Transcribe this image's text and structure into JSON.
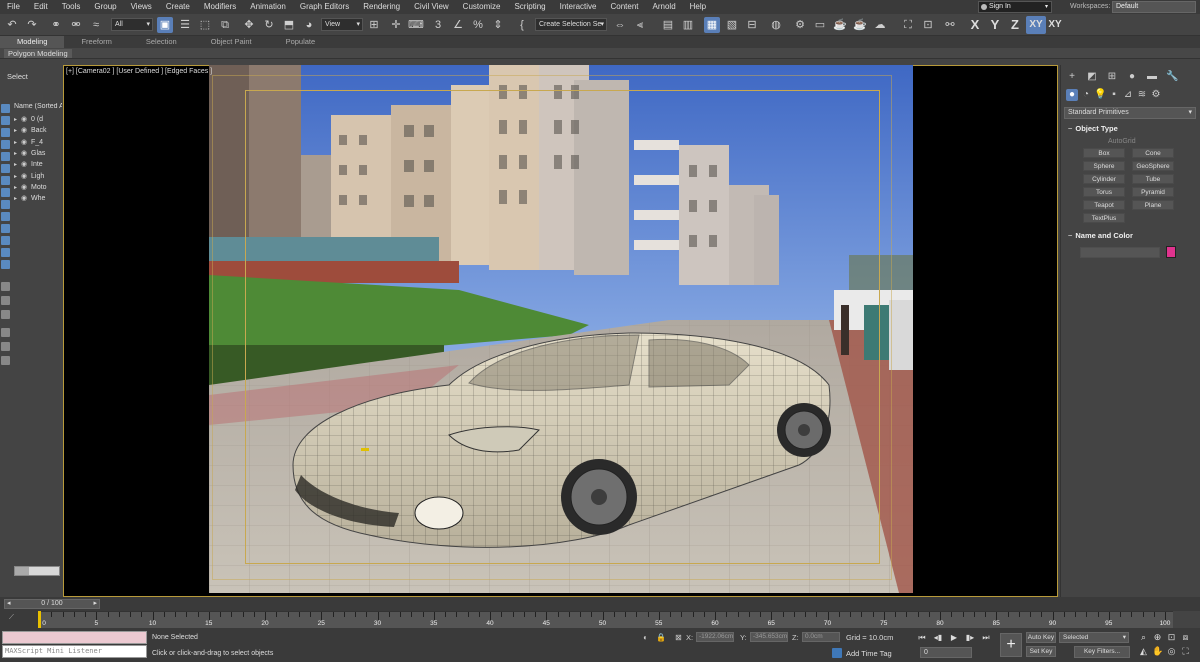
{
  "menu": [
    "File",
    "Edit",
    "Tools",
    "Group",
    "Views",
    "Create",
    "Modifiers",
    "Animation",
    "Graph Editors",
    "Rendering",
    "Civil View",
    "Customize",
    "Scripting",
    "Interactive",
    "Content",
    "Arnold",
    "Help"
  ],
  "account": {
    "sign_in": "Sign In",
    "workspaces_label": "Workspaces:",
    "workspace": "Default"
  },
  "toolbar": {
    "filter": "All",
    "ref_coord": "View",
    "selection_set": "Create Selection Se",
    "axis_x": "X",
    "axis_y": "Y",
    "axis_z": "Z",
    "axis_xy": "XY",
    "axis_xy2": "XY"
  },
  "ribbon": {
    "tabs": [
      "Modeling",
      "Freeform",
      "Selection",
      "Object Paint",
      "Populate"
    ],
    "subtab": "Polygon Modeling"
  },
  "scene_explorer": {
    "select_label": "Select",
    "header": "Name (Sorted A",
    "rows": [
      "0 (d",
      "Back",
      "F_4",
      "Glas",
      "Inte",
      "Ligh",
      "Moto",
      "Whe"
    ]
  },
  "viewport": {
    "label": "[+] [Camera02 ] [User Defined ] [Edged Faces ]"
  },
  "command_panel": {
    "category": "Standard Primitives",
    "object_type_title": "Object Type",
    "autogrid": "AutoGrid",
    "primitives": [
      "Box",
      "Cone",
      "Sphere",
      "GeoSphere",
      "Cylinder",
      "Tube",
      "Torus",
      "Pyramid",
      "Teapot",
      "Plane",
      "TextPlus"
    ],
    "name_color_title": "Name and Color",
    "object_color": "#e0338e"
  },
  "timeline": {
    "frame_range": "0 / 100",
    "tick_labels": [
      "0",
      "5",
      "10",
      "15",
      "20",
      "25",
      "30",
      "35",
      "40",
      "45",
      "50",
      "55",
      "60",
      "65",
      "70",
      "75",
      "80",
      "85",
      "90",
      "95",
      "100"
    ]
  },
  "status": {
    "maxscript": "MAXScript Mini Listener",
    "selection": "None Selected",
    "prompt": "Click or click-and-drag to select objects",
    "x_label": "X:",
    "x_value": "-1922.06cm",
    "y_label": "Y:",
    "y_value": "-345.653cm",
    "z_label": "Z:",
    "z_value": "0.0cm",
    "grid": "Grid = 10.0cm",
    "add_time_tag": "Add Time Tag",
    "current_frame": "0",
    "auto_key": "Auto Key",
    "set_key": "Set Key",
    "key_mode": "Selected",
    "key_filters": "Key Filters..."
  }
}
